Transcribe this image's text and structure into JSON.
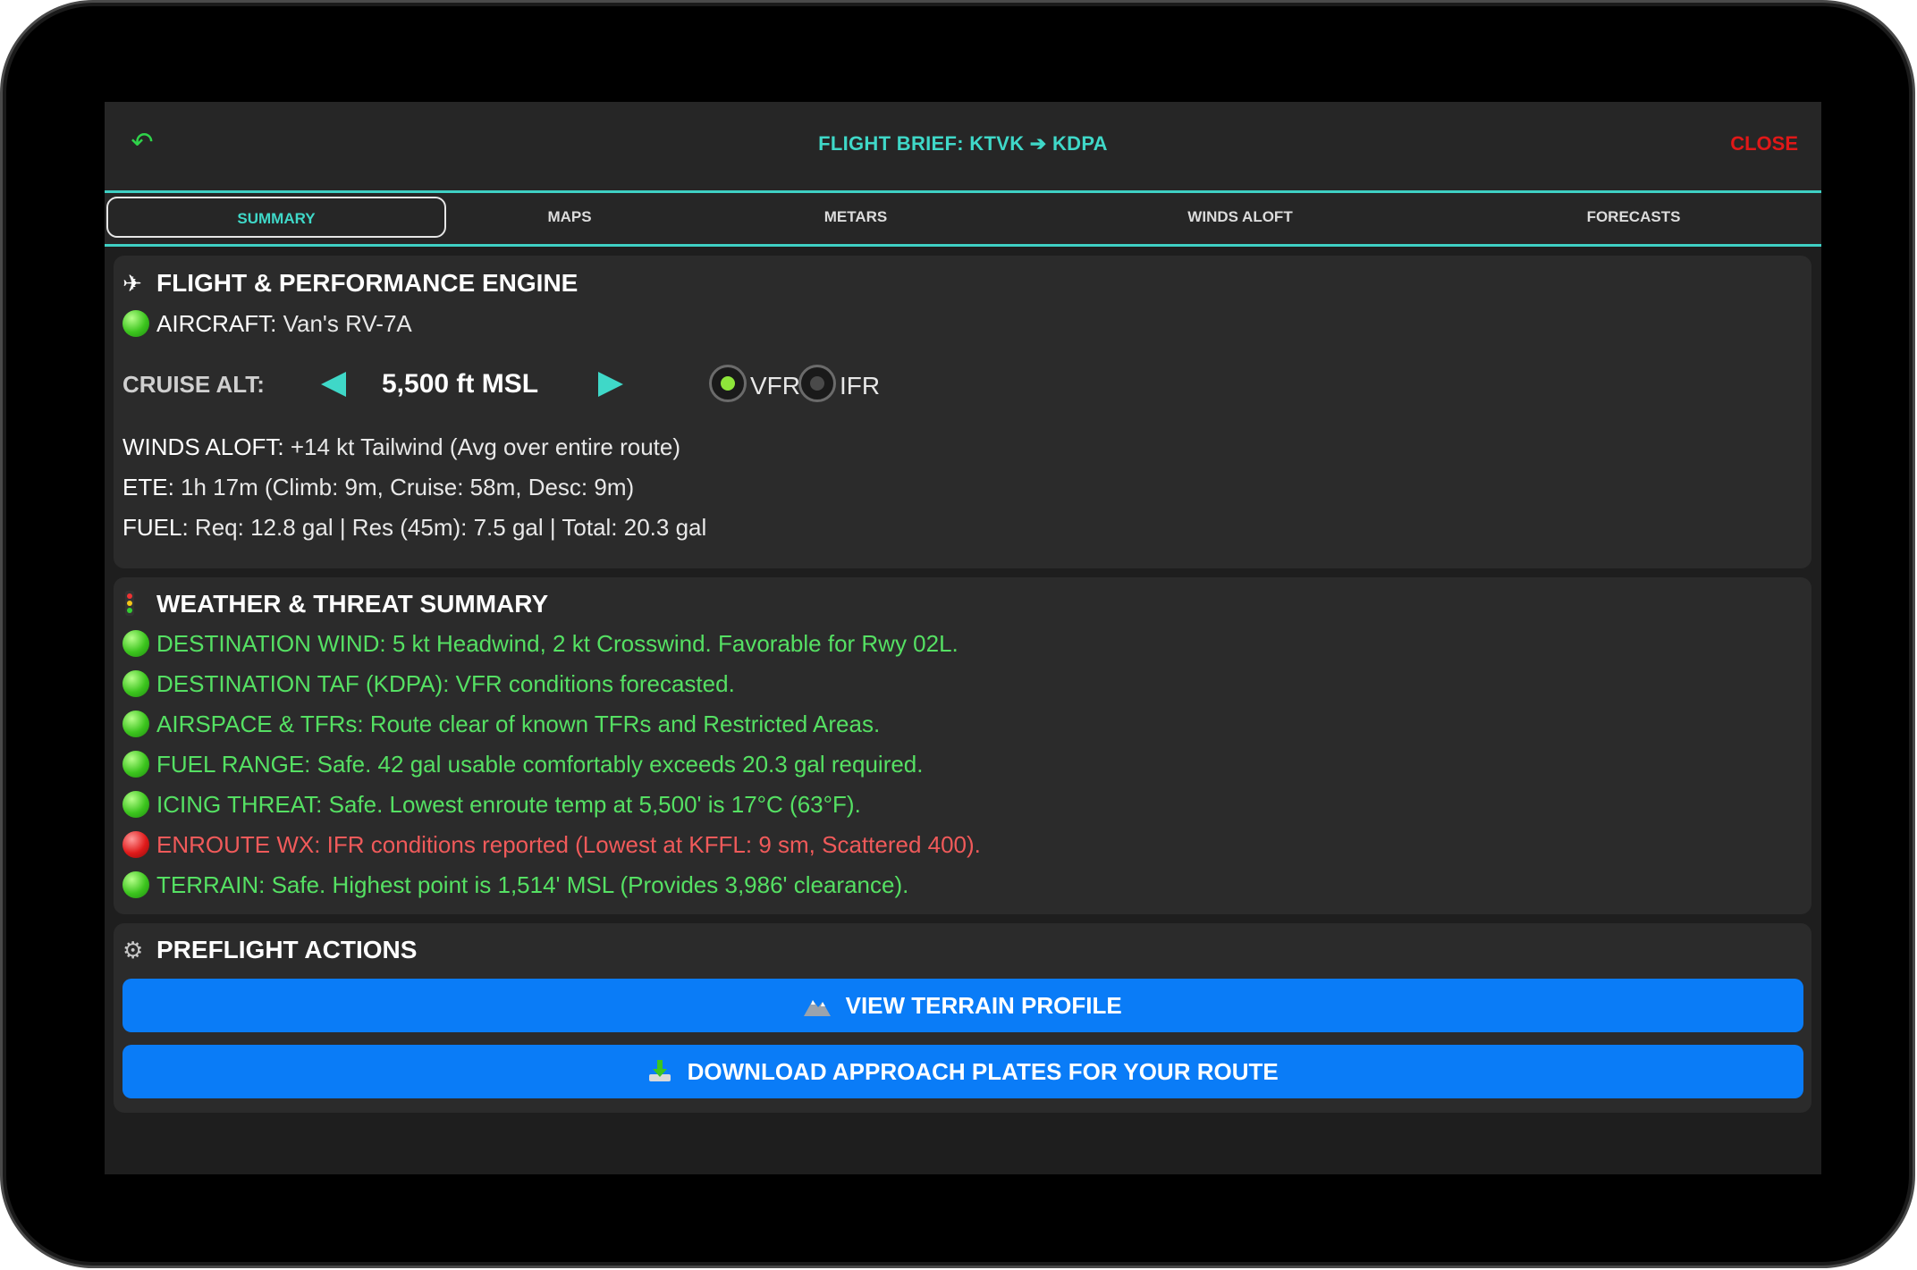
{
  "header": {
    "title": "FLIGHT BRIEF: KTVK ➔ KDPA",
    "close_label": "CLOSE",
    "back_icon": "undo-icon"
  },
  "tabs": [
    {
      "label": "SUMMARY",
      "active": true
    },
    {
      "label": "MAPS",
      "active": false
    },
    {
      "label": "METARS",
      "active": false
    },
    {
      "label": "WINDS ALOFT",
      "active": false
    },
    {
      "label": "FORECASTS",
      "active": false
    }
  ],
  "performance": {
    "heading": "FLIGHT & PERFORMANCE ENGINE",
    "icon": "airplane-icon",
    "aircraft_label": "AIRCRAFT:",
    "aircraft_value": "Van's RV-7A",
    "cruise_label": "CRUISE ALT:",
    "cruise_value": "5,500 ft MSL",
    "flight_rules": [
      {
        "label": "VFR",
        "selected": true
      },
      {
        "label": "IFR",
        "selected": false
      }
    ],
    "winds_label": "WINDS ALOFT:",
    "winds_value": "+14 kt Tailwind (Avg over entire route)",
    "ete_label": "ETE:",
    "ete_value": "1h 17m (Climb: 9m, Cruise: 58m, Desc: 9m)",
    "fuel_label": "FUEL:",
    "fuel_value": "Req: 12.8 gal | Res (45m): 7.5 gal | Total: 20.3 gal"
  },
  "weather": {
    "heading": "WEATHER & THREAT SUMMARY",
    "icon": "traffic-light-icon",
    "items": [
      {
        "status": "green",
        "text": "DESTINATION WIND: 5 kt Headwind, 2 kt Crosswind. Favorable for Rwy 02L."
      },
      {
        "status": "green",
        "text": "DESTINATION TAF (KDPA): VFR conditions forecasted."
      },
      {
        "status": "green",
        "text": "AIRSPACE & TFRs: Route clear of known TFRs and Restricted Areas."
      },
      {
        "status": "green",
        "text": "FUEL RANGE: Safe. 42 gal usable comfortably exceeds 20.3 gal required."
      },
      {
        "status": "green",
        "text": "ICING THREAT: Safe. Lowest enroute temp at 5,500' is 17°C (63°F)."
      },
      {
        "status": "red",
        "text": "ENROUTE WX: IFR conditions reported (Lowest at KFFL: 9 sm, Scattered 400)."
      },
      {
        "status": "green",
        "text": "TERRAIN: Safe. Highest point is 1,514' MSL (Provides 3,986' clearance)."
      }
    ]
  },
  "actions": {
    "heading": "PREFLIGHT ACTIONS",
    "icon": "gear-icon",
    "terrain_button": "VIEW TERRAIN PROFILE",
    "terrain_icon": "mountain-icon",
    "download_button": "DOWNLOAD APPROACH PLATES FOR YOUR ROUTE",
    "download_icon": "download-icon"
  },
  "colors": {
    "accent": "#3fd8c8",
    "ok": "#55e063",
    "warn": "#f05a5a",
    "button": "#0a7cf7",
    "close": "#e01818"
  }
}
